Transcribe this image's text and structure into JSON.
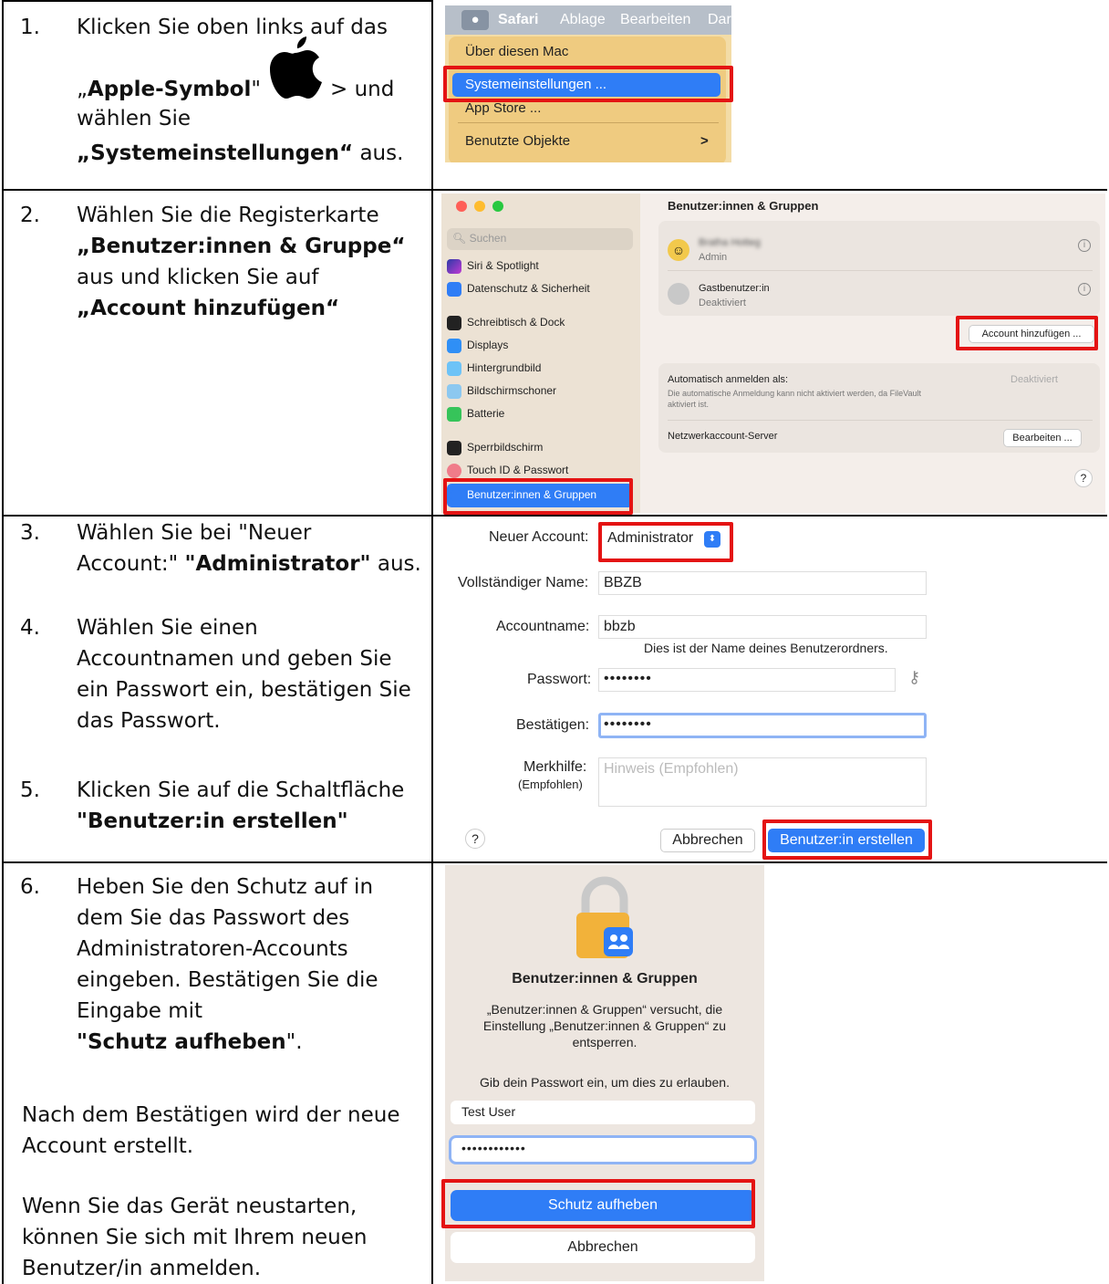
{
  "steps": {
    "s1": {
      "num": "1.",
      "line1": "Klicken Sie oben links auf das",
      "quote_open": "„",
      "apple_bold": "Apple-Symbol",
      "quote_close": "\"",
      "gt_und": "> und",
      "line3": "wählen Sie",
      "sys_bold": "„Systemeinstellungen“",
      "aus": " aus."
    },
    "s2": {
      "num": "2.",
      "line1": "Wählen Sie die Registerkarte",
      "line2_bold": "„Benutzer:innen & Gruppe“",
      "line3": "aus und klicken Sie auf",
      "line4_bold": "„Account hinzufügen“"
    },
    "s3": {
      "num": "3.",
      "line1": "Wählen Sie bei \"Neuer",
      "line2_pre": "Account:\" ",
      "line2_bold": "\"Administrator\"",
      "line2_post": " aus."
    },
    "s4": {
      "num": "4.",
      "line1": "Wählen Sie einen",
      "line2": "Accountnamen und geben Sie",
      "line3": "ein Passwort ein, bestätigen Sie",
      "line4": "das Passwort."
    },
    "s5": {
      "num": "5.",
      "line1": "Klicken Sie auf die Schaltfläche",
      "line2_bold": "\"Benutzer:in erstellen\""
    },
    "s6": {
      "num": "6.",
      "line1": "Heben Sie den Schutz auf in",
      "line2": "dem Sie das Passwort des",
      "line3": "Administratoren-Accounts",
      "line4": "eingeben. Bestätigen Sie die",
      "line5": "Eingabe mit",
      "line6_bold": "\"Schutz aufheben",
      "line6_post": "\".",
      "para2_l1": "Nach dem Bestätigen wird der neue",
      "para2_l2": "Account erstellt.",
      "para3_l1": "Wenn Sie das Gerät neustarten,",
      "para3_l2": "können Sie sich mit Ihrem neuen",
      "para3_l3": "Benutzer/in anmelden."
    }
  },
  "shot1": {
    "menubar": [
      "Safari",
      "Ablage",
      "Bearbeiten",
      "Dar"
    ],
    "items": [
      "Über diesen Mac",
      "Systemeinstellungen ...",
      "App Store ...",
      "Benutzte Objekte"
    ],
    "chevron": ">"
  },
  "shot2": {
    "search_placeholder": "Suchen",
    "sidebar": [
      "Siri & Spotlight",
      "Datenschutz & Sicherheit",
      "Schreibtisch & Dock",
      "Displays",
      "Hintergrundbild",
      "Bildschirmschoner",
      "Batterie",
      "Sperrbildschirm",
      "Touch ID & Passwort",
      "Benutzer:innen & Gruppen"
    ],
    "title": "Benutzer:innen & Gruppen",
    "user1_name": "Bratha Hotteg",
    "user1_role": "Admin",
    "guest_name": "Gastbenutzer:in",
    "guest_status": "Deaktiviert",
    "add_account": "Account hinzufügen ...",
    "auto_login": "Automatisch anmelden als:",
    "auto_login_value": "Deaktiviert",
    "auto_login_note1": "Die automatische Anmeldung kann nicht aktiviert werden, da FileVault",
    "auto_login_note2": "aktiviert ist.",
    "net_server": "Netzwerkaccount-Server",
    "edit_button": "Bearbeiten ...",
    "help": "?"
  },
  "shot3": {
    "new_account_label": "Neuer Account:",
    "new_account_value": "Administrator",
    "fullname_label": "Vollständiger Name:",
    "fullname_value": "BBZB",
    "account_label": "Accountname:",
    "account_value": "bbzb",
    "account_hint": "Dies ist der Name deines Benutzerordners.",
    "password_label": "Passwort:",
    "password_value": "••••••••",
    "confirm_label": "Bestätigen:",
    "confirm_value": "••••••••",
    "hint_label": "Merkhilfe:",
    "hint_sub": "(Empfohlen)",
    "hint_placeholder": "Hinweis (Empfohlen)",
    "help": "?",
    "cancel": "Abbrechen",
    "create": "Benutzer:in erstellen"
  },
  "shot4": {
    "title": "Benutzer:innen & Gruppen",
    "msg1": "„Benutzer:innen & Gruppen“ versucht, die",
    "msg2": "Einstellung „Benutzer:innen & Gruppen“ zu",
    "msg3": "entsperren.",
    "prompt": "Gib dein Passwort ein, um dies zu erlauben.",
    "username": "Test User",
    "password": "••••••••••••",
    "unlock": "Schutz aufheben",
    "cancel": "Abbrechen"
  },
  "colors": {
    "highlight_red": "#e41313",
    "mac_blue": "#2f7df6"
  }
}
